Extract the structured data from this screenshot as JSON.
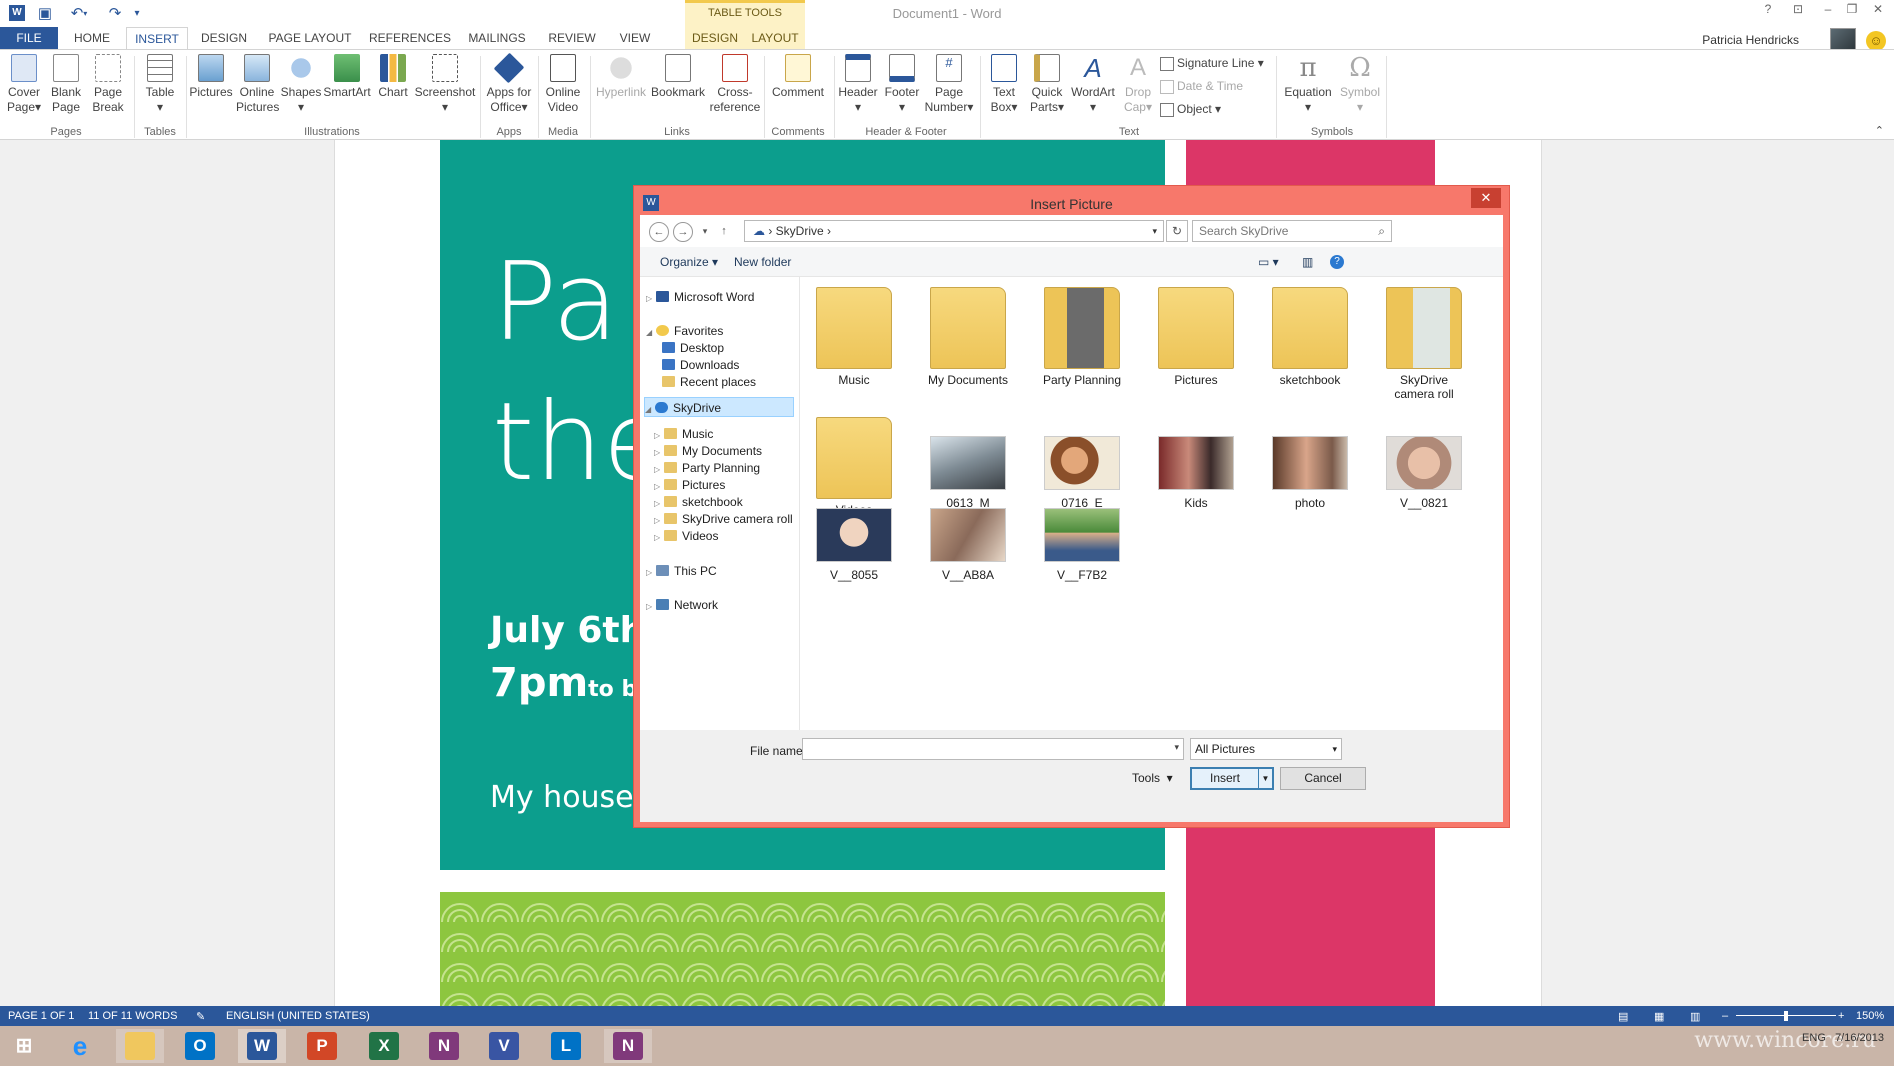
{
  "window": {
    "title": "Document1 - Word",
    "context_group": "TABLE TOOLS",
    "user": "Patricia Hendricks"
  },
  "tabs": [
    "FILE",
    "HOME",
    "INSERT",
    "DESIGN",
    "PAGE LAYOUT",
    "REFERENCES",
    "MAILINGS",
    "REVIEW",
    "VIEW",
    "DESIGN",
    "LAYOUT"
  ],
  "ribbon": {
    "groups": {
      "pages": "Pages",
      "tables": "Tables",
      "illustrations": "Illustrations",
      "apps": "Apps",
      "media": "Media",
      "links": "Links",
      "comments": "Comments",
      "header_footer": "Header & Footer",
      "text": "Text",
      "symbols": "Symbols"
    },
    "buttons": {
      "cover_page": "Cover",
      "cover_page2": "Page",
      "blank_page": "Blank",
      "blank_page2": "Page",
      "page_break": "Page",
      "page_break2": "Break",
      "table": "Table",
      "pictures": "Pictures",
      "online_pictures": "Online",
      "online_pictures2": "Pictures",
      "shapes": "Shapes",
      "smartart": "SmartArt",
      "chart": "Chart",
      "screenshot": "Screenshot",
      "apps_for_office": "Apps for",
      "apps_for_office2": "Office",
      "online_video": "Online",
      "online_video2": "Video",
      "hyperlink": "Hyperlink",
      "bookmark": "Bookmark",
      "cross_reference": "Cross-",
      "cross_reference2": "reference",
      "comment": "Comment",
      "header": "Header",
      "footer": "Footer",
      "page_number": "Page",
      "page_number2": "Number",
      "text_box": "Text",
      "text_box2": "Box",
      "quick_parts": "Quick",
      "quick_parts2": "Parts",
      "wordart": "WordArt",
      "drop_cap": "Drop",
      "drop_cap2": "Cap",
      "signature_line": "Signature Line",
      "date_time": "Date & Time",
      "object": "Object",
      "equation": "Equation",
      "symbol": "Symbol"
    }
  },
  "poster": {
    "line1": "Pa",
    "line2": "the",
    "date": "July 6th",
    "time": "7pm",
    "time_suffix": "to b",
    "place": "My house"
  },
  "dialog": {
    "title": "Insert Picture",
    "path": "SkyDrive",
    "search_placeholder": "Search SkyDrive",
    "toolbar": {
      "organize": "Organize",
      "new_folder": "New folder"
    },
    "nav": {
      "microsoft_word": "Microsoft Word",
      "favorites": "Favorites",
      "favorites_items": [
        "Desktop",
        "Downloads",
        "Recent places"
      ],
      "skydrive": "SkyDrive",
      "skydrive_items": [
        "Music",
        "My Documents",
        "Party Planning",
        "Pictures",
        "sketchbook",
        "SkyDrive camera roll",
        "Videos"
      ],
      "this_pc": "This PC",
      "network": "Network"
    },
    "folders": [
      "Music",
      "My Documents",
      "Party Planning",
      "Pictures",
      "sketchbook",
      "SkyDrive camera roll",
      "Videos"
    ],
    "photos": [
      "0613_M",
      "0716_E",
      "Kids",
      "photo",
      "V__0821",
      "V__8055",
      "V__AB8A",
      "V__F7B2"
    ],
    "file_name_label": "File name:",
    "file_name_value": "",
    "filter": "All Pictures",
    "tools": "Tools",
    "insert": "Insert",
    "cancel": "Cancel"
  },
  "status": {
    "page": "PAGE 1 OF 1",
    "words": "11 OF 11 WORDS",
    "language": "ENGLISH (UNITED STATES)",
    "zoom": "150%"
  },
  "taskbar": {
    "lang": "ENG",
    "date": "7/16/2013",
    "watermark": "www.wincore.ru"
  },
  "colors": {
    "word_blue": "#2b579a",
    "dialog_frame": "#f7786b",
    "poster_teal": "#0c9e8d",
    "poster_pink": "#dc3667",
    "poster_green": "#8dc63f"
  }
}
